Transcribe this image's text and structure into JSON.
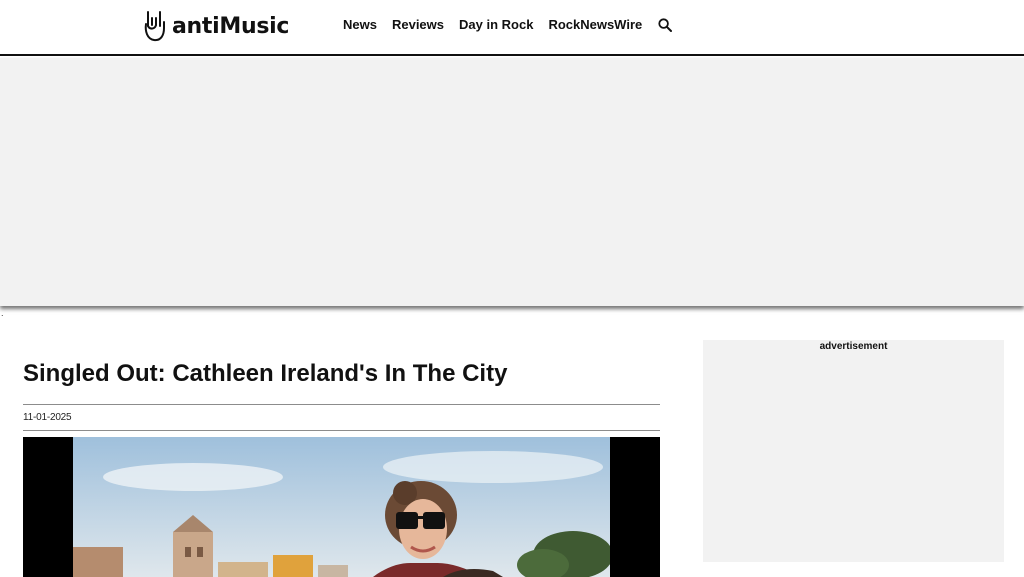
{
  "header": {
    "logo_text": "antiMusic",
    "nav": [
      {
        "label": "News"
      },
      {
        "label": "Reviews"
      },
      {
        "label": "Day in Rock"
      },
      {
        "label": "RockNewsWire"
      }
    ],
    "search_icon": "search-icon"
  },
  "stray_text": ".",
  "article": {
    "title": "Singled Out: Cathleen Ireland's In The City",
    "date": "11-01-2025"
  },
  "sidebar": {
    "ad_label": "advertisement"
  },
  "colors": {
    "text": "#111111",
    "ad_background": "#f2f2f2",
    "divider": "#8c8c8c"
  }
}
